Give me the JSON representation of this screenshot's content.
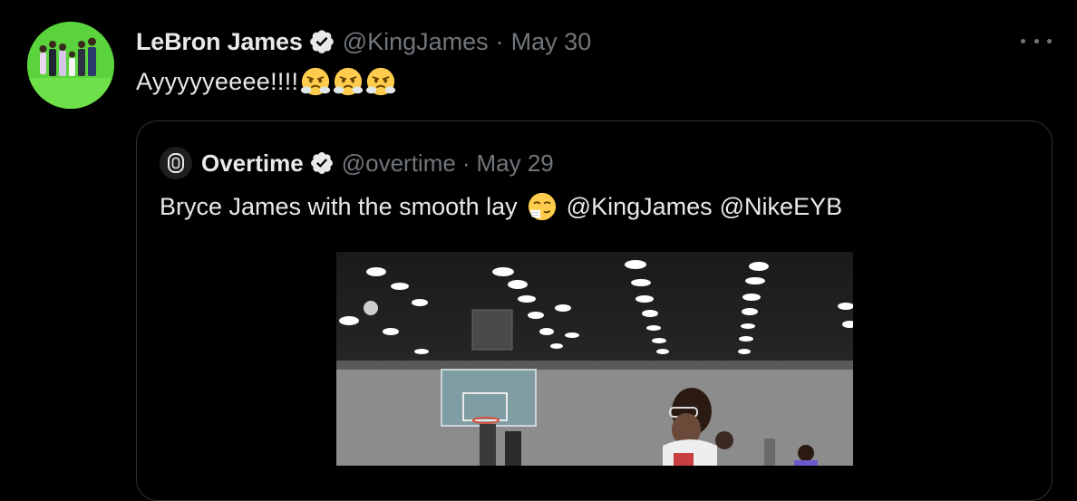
{
  "tweet": {
    "author_name": "LeBron James",
    "handle": "@KingJames",
    "separator": "·",
    "date": "May 30",
    "text": "Ayyyyyeeee!!!!",
    "emojis": [
      "face-with-steam-emoji",
      "face-with-steam-emoji",
      "face-with-steam-emoji"
    ],
    "more_icon": "more-horizontal-icon"
  },
  "quoted": {
    "author_name": "Overtime",
    "handle": "@overtime",
    "separator": "·",
    "date": "May 29",
    "text": "Bryce James with the smooth lay",
    "emoji": "sneezing-face-emoji",
    "mentions": [
      "@KingJames",
      "@NikeEYB"
    ]
  },
  "colors": {
    "background": "#000000",
    "primary_text": "#e7e9ea",
    "secondary_text": "#71767b",
    "border": "#2f3336",
    "verified_badge": "#e7e9ea"
  }
}
